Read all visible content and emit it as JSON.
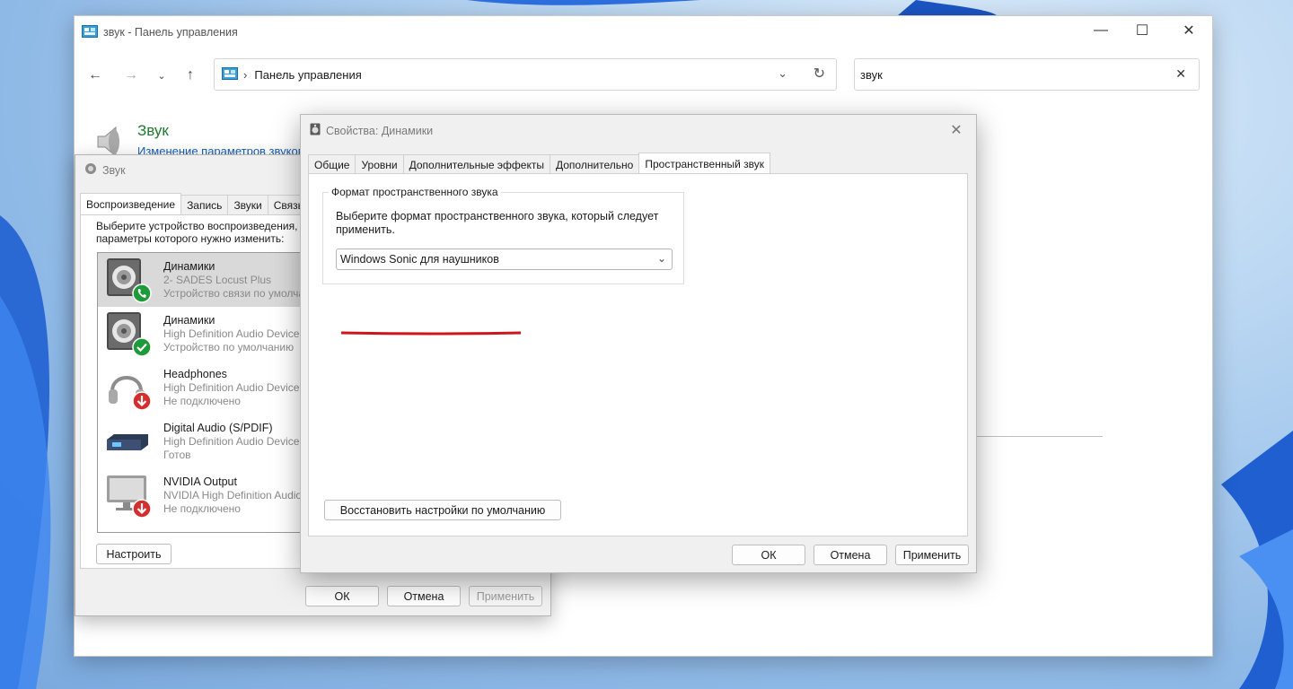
{
  "control_panel": {
    "title": "звук - Панель управления",
    "address": "Панель управления",
    "search_value": "звук",
    "sound_heading": "Звук",
    "sound_link": "Изменение параметров звуковых устройств"
  },
  "sound_dialog": {
    "title": "Звук",
    "tabs": [
      "Воспроизведение",
      "Запись",
      "Звуки",
      "Связь"
    ],
    "prompt": "Выберите устройство воспроизведения, параметры которого нужно изменить:",
    "devices": [
      {
        "name": "Динамики",
        "line2": "2- SADES Locust Plus",
        "line3": "Устройство связи по умолчанию",
        "icon": "speaker-icon",
        "badge": "phone-badge-icon"
      },
      {
        "name": "Динамики",
        "line2": "High Definition Audio Device",
        "line3": "Устройство по умолчанию",
        "icon": "speaker-icon",
        "badge": "check-badge-icon"
      },
      {
        "name": "Headphones",
        "line2": "High Definition Audio Device",
        "line3": "Не подключено",
        "icon": "headphones-icon",
        "badge": "down-arrow-badge-icon"
      },
      {
        "name": "Digital Audio (S/PDIF)",
        "line2": "High Definition Audio Device",
        "line3": "Готов",
        "icon": "digital-audio-icon",
        "badge": ""
      },
      {
        "name": "NVIDIA Output",
        "line2": "NVIDIA High Definition Audio",
        "line3": "Не подключено",
        "icon": "monitor-icon",
        "badge": "down-arrow-badge-icon"
      }
    ],
    "configure_label": "Настроить",
    "ok_label": "ОК",
    "cancel_label": "Отмена",
    "apply_label": "Применить"
  },
  "properties_dialog": {
    "title": "Свойства: Динамики",
    "tabs": [
      "Общие",
      "Уровни",
      "Дополнительные эффекты",
      "Дополнительно",
      "Пространственный звук"
    ],
    "active_tab_index": 4,
    "group_label": "Формат пространственного звука",
    "group_desc": "Выберите формат пространственного звука, который следует применить.",
    "format_value": "Windows Sonic для наушников",
    "restore_label": "Восстановить настройки по умолчанию",
    "ok_label": "ОК",
    "cancel_label": "Отмена",
    "apply_label": "Применить",
    "highlight_color": "#d0141c"
  }
}
